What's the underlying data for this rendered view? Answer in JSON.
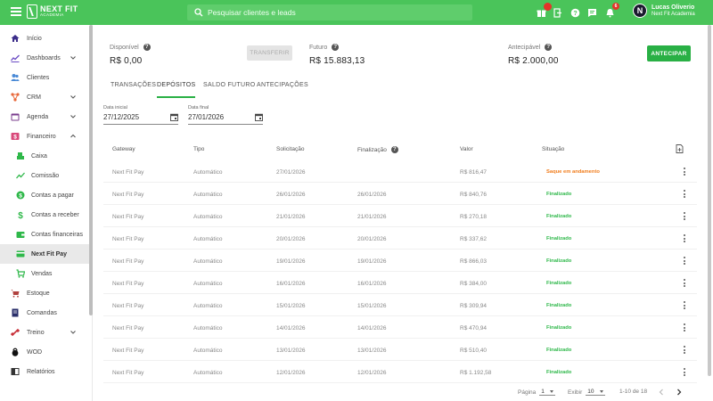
{
  "header": {
    "logo_title": "NEXT FIT",
    "logo_sub": "ACADEMIA",
    "search_placeholder": "Pesquisar clientes e leads",
    "notifications_count": "6",
    "user_initial": "N",
    "user_name": "Lucas Oliverio",
    "user_org": "Next Fit Academia",
    "icons": [
      "gift-icon",
      "exit-icon",
      "help-icon",
      "chat-icon",
      "bell-icon"
    ]
  },
  "sidebar": {
    "items": [
      {
        "label": "Início",
        "icon": "home-icon"
      },
      {
        "label": "Dashboards",
        "icon": "chart-icon"
      },
      {
        "label": "Clientes",
        "icon": "people-icon"
      },
      {
        "label": "CRM",
        "icon": "crm-icon"
      },
      {
        "label": "Agenda",
        "icon": "calendar-icon"
      },
      {
        "label": "Financeiro",
        "icon": "money-icon"
      },
      {
        "label": "Caixa",
        "icon": "cash-icon"
      },
      {
        "label": "Comissão",
        "icon": "trend-icon"
      },
      {
        "label": "Contas a pagar",
        "icon": "dollar-circle-icon"
      },
      {
        "label": "Contas a receber",
        "icon": "dollar-icon"
      },
      {
        "label": "Contas financeiras",
        "icon": "wallet-icon"
      },
      {
        "label": "Next Fit Pay",
        "icon": "card-icon"
      },
      {
        "label": "Vendas",
        "icon": "cart-icon"
      },
      {
        "label": "Estoque",
        "icon": "stock-cart-icon"
      },
      {
        "label": "Comandas",
        "icon": "tab-icon"
      },
      {
        "label": "Treino",
        "icon": "dumbbell-icon"
      },
      {
        "label": "WOD",
        "icon": "kettlebell-icon"
      },
      {
        "label": "Relatórios",
        "icon": "report-icon"
      }
    ]
  },
  "summary": {
    "available_label": "Disponível",
    "available_value": "R$ 0,00",
    "transfer_label": "TRANSFERIR",
    "future_label": "Futuro",
    "future_value": "R$ 15.883,13",
    "anticipable_label": "Antecipável",
    "anticipable_value": "R$ 2.000,00",
    "anticipate_label": "ANTECIPAR"
  },
  "tabs": [
    "TRANSAÇÕES",
    "DEPÓSITOS",
    "SALDO FUTURO",
    "ANTECIPAÇÕES"
  ],
  "active_tab": "DEPÓSITOS",
  "filters": {
    "start_label": "Data inicial",
    "start_value": "27/12/2025",
    "end_label": "Data final",
    "end_value": "27/01/2026"
  },
  "table": {
    "columns": [
      "Gateway",
      "Tipo",
      "Solicitação",
      "Finalização",
      "Valor",
      "Situação"
    ],
    "rows": [
      {
        "gateway": "Next Fit Pay",
        "tipo": "Automático",
        "solicitacao": "27/01/2026",
        "finalizacao": "",
        "valor": "R$ 816,47",
        "situacao": "Saque em andamento"
      },
      {
        "gateway": "Next Fit Pay",
        "tipo": "Automático",
        "solicitacao": "26/01/2026",
        "finalizacao": "26/01/2026",
        "valor": "R$ 840,76",
        "situacao": "Finalizado"
      },
      {
        "gateway": "Next Fit Pay",
        "tipo": "Automático",
        "solicitacao": "21/01/2026",
        "finalizacao": "21/01/2026",
        "valor": "R$ 270,18",
        "situacao": "Finalizado"
      },
      {
        "gateway": "Next Fit Pay",
        "tipo": "Automático",
        "solicitacao": "20/01/2026",
        "finalizacao": "20/01/2026",
        "valor": "R$ 337,62",
        "situacao": "Finalizado"
      },
      {
        "gateway": "Next Fit Pay",
        "tipo": "Automático",
        "solicitacao": "19/01/2026",
        "finalizacao": "19/01/2026",
        "valor": "R$ 866,03",
        "situacao": "Finalizado"
      },
      {
        "gateway": "Next Fit Pay",
        "tipo": "Automático",
        "solicitacao": "16/01/2026",
        "finalizacao": "16/01/2026",
        "valor": "R$ 384,00",
        "situacao": "Finalizado"
      },
      {
        "gateway": "Next Fit Pay",
        "tipo": "Automático",
        "solicitacao": "15/01/2026",
        "finalizacao": "15/01/2026",
        "valor": "R$ 309,94",
        "situacao": "Finalizado"
      },
      {
        "gateway": "Next Fit Pay",
        "tipo": "Automático",
        "solicitacao": "14/01/2026",
        "finalizacao": "14/01/2026",
        "valor": "R$ 470,94",
        "situacao": "Finalizado"
      },
      {
        "gateway": "Next Fit Pay",
        "tipo": "Automático",
        "solicitacao": "13/01/2026",
        "finalizacao": "13/01/2026",
        "valor": "R$ 510,40",
        "situacao": "Finalizado"
      },
      {
        "gateway": "Next Fit Pay",
        "tipo": "Automático",
        "solicitacao": "12/01/2026",
        "finalizacao": "12/01/2026",
        "valor": "R$ 1.192,58",
        "situacao": "Finalizado"
      }
    ]
  },
  "pagination": {
    "page_label": "Página",
    "page_value": "1",
    "show_label": "Exibir",
    "show_value": "10",
    "range_text": "1-10 de 18"
  },
  "colors": {
    "brand_green": "#4ac45a",
    "button_green": "#29b045",
    "status_finalizado": "#2fb84a",
    "status_andamento": "#f07c1b"
  }
}
